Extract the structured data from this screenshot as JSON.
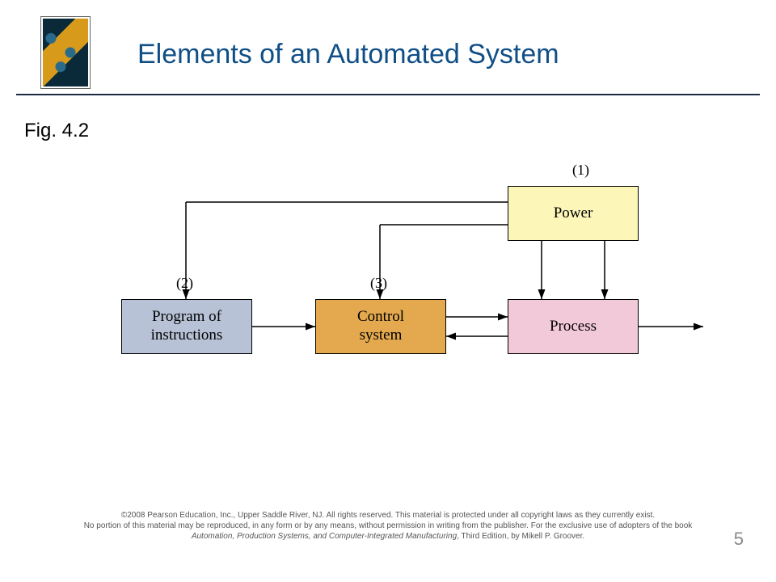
{
  "slide": {
    "title": "Elements of an Automated System",
    "caption": "Fig. 4.2",
    "page_number": "5"
  },
  "diagram": {
    "nodes": {
      "power": {
        "label": "Power",
        "num": "(1)"
      },
      "program": {
        "label": "Program of\ninstructions",
        "num": "(2)"
      },
      "control": {
        "label": "Control\nsystem",
        "num": "(3)"
      },
      "process": {
        "label": "Process"
      }
    },
    "edges_description": [
      "Power → Program of instructions",
      "Power → Control system",
      "Power → Process",
      "Program of instructions → Control system",
      "Control system ↔ Process (bidirectional)",
      "Process → (output)"
    ]
  },
  "footer": {
    "line1": "©2008 Pearson Education, Inc., Upper Saddle River, NJ.  All rights reserved.  This material is protected under all copyright laws as they currently exist.",
    "line2": "No portion of this material may be reproduced, in any form or by any means, without permission in writing from the publisher.  For the exclusive use of adopters of the book",
    "book": "Automation, Production Systems, and Computer-Integrated Manufacturing",
    "tail": ", Third Edition, by Mikell P. Groover."
  }
}
